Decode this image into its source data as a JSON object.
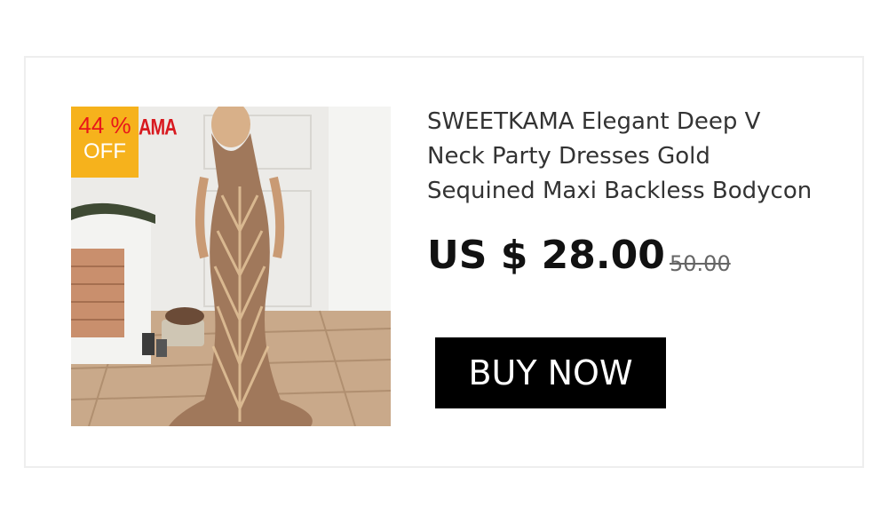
{
  "product": {
    "title": "SWEETKAMA Elegant Deep V\nNeck Party Dresses Gold\nSequined Maxi  Backless Bodycon",
    "price": "US $ 28.00",
    "original_price": "50.00",
    "discount": {
      "percent": "44 %",
      "label": "OFF"
    },
    "brand_logo": "AMA",
    "image_icon": "dress-photo"
  },
  "actions": {
    "buy_label": "BUY NOW"
  },
  "colors": {
    "badge_bg": "#f6b21c",
    "badge_percent": "#e8161a",
    "button_bg": "#000000",
    "price": "#111111"
  }
}
